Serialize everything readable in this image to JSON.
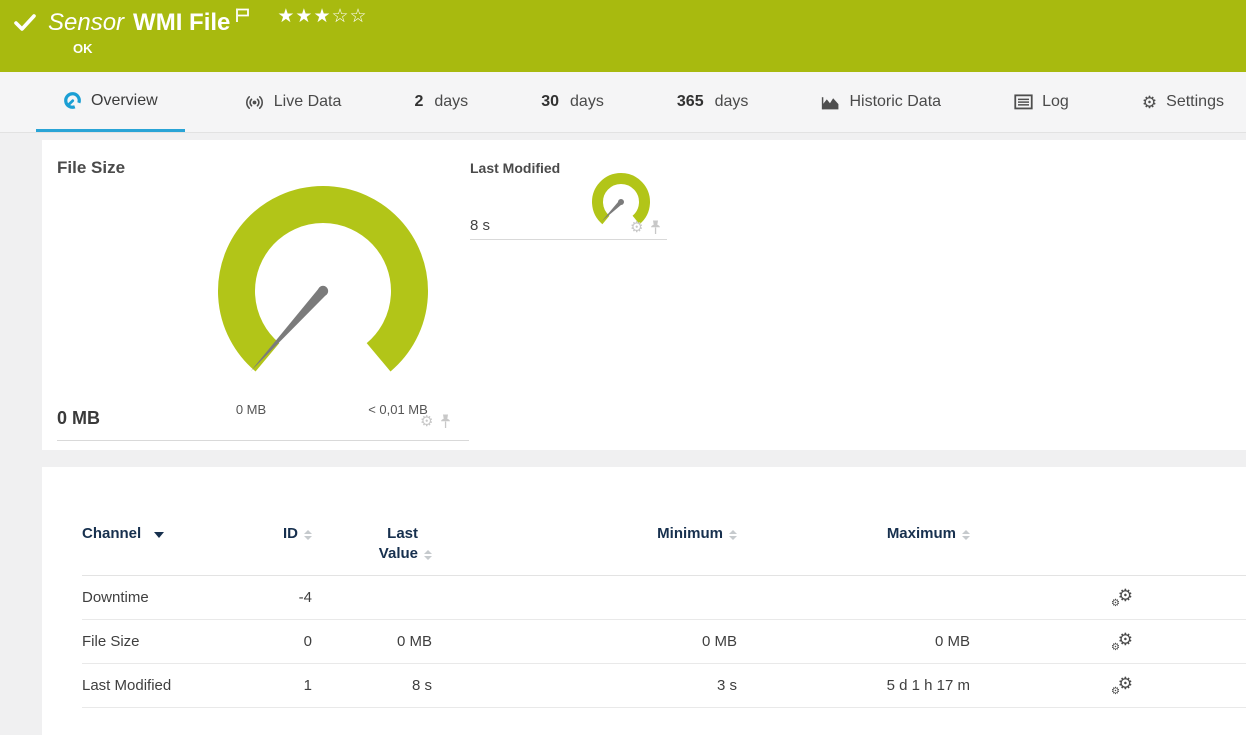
{
  "colors": {
    "brand_green": "#a8ba0f",
    "gauge_green": "#b2c518",
    "active_tab_blue": "#29a4d6",
    "table_header_navy": "#17304e",
    "needle_gray": "#7b7b7b"
  },
  "header": {
    "kind_label": "Sensor",
    "title": "WMI File",
    "status": "OK",
    "stars_filled": "★★★",
    "stars_empty": "☆☆"
  },
  "tabs": {
    "overview": {
      "label": "Overview"
    },
    "live_data": {
      "label": "Live Data"
    },
    "d2": {
      "num": "2",
      "unit": "days"
    },
    "d30": {
      "num": "30",
      "unit": "days"
    },
    "d365": {
      "num": "365",
      "unit": "days"
    },
    "historic": {
      "label": "Historic Data"
    },
    "log": {
      "label": "Log"
    },
    "settings": {
      "label": "Settings"
    }
  },
  "gauges": {
    "file_size": {
      "title": "File Size",
      "value": "0 MB",
      "scale_min": "0 MB",
      "scale_max": "< 0,01 MB"
    },
    "last_modified": {
      "title": "Last Modified",
      "value": "8 s"
    }
  },
  "channel_table": {
    "headers": {
      "channel": "Channel",
      "id": "ID",
      "last_value": "Last Value",
      "minimum": "Minimum",
      "maximum": "Maximum"
    },
    "rows": [
      {
        "channel": "Downtime",
        "id": "-4",
        "last_value": "",
        "minimum": "",
        "maximum": ""
      },
      {
        "channel": "File Size",
        "id": "0",
        "last_value": "0 MB",
        "minimum": "0 MB",
        "maximum": "0 MB"
      },
      {
        "channel": "Last Modified",
        "id": "1",
        "last_value": "8 s",
        "minimum": "3 s",
        "maximum": "5 d 1 h 17 m"
      }
    ]
  },
  "icons": {
    "gear_glyph": "⚙"
  }
}
